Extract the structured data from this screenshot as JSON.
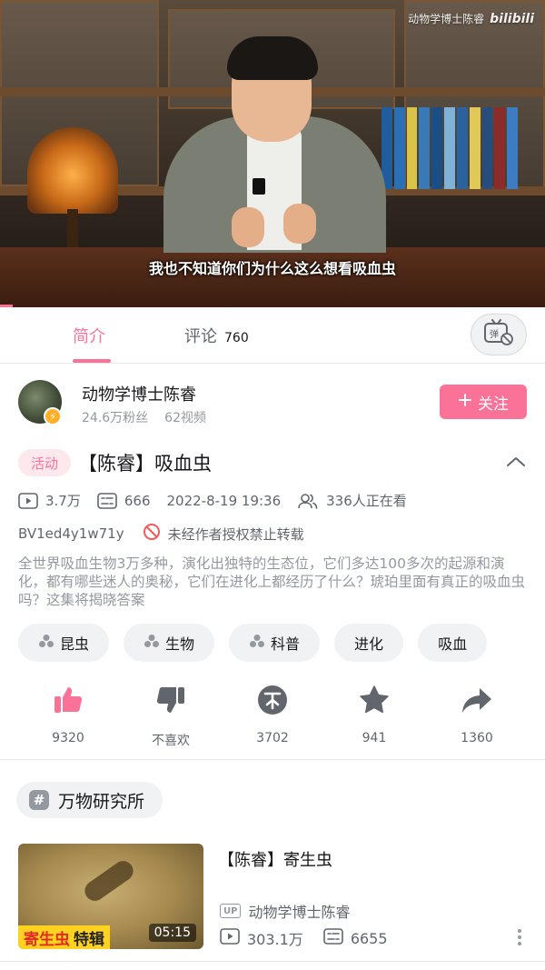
{
  "player": {
    "watermark_text": "动物学博士陈睿",
    "watermark_logo": "bilibili",
    "subtitle": "我也不知道你们为什么这么想看吸血虫"
  },
  "tabs": {
    "intro_label": "简介",
    "comments_label": "评论",
    "comments_count": "760",
    "danmaku_icon": "danmaku-off-icon"
  },
  "uploader": {
    "name": "动物学博士陈睿",
    "fans": "24.6万粉丝",
    "videos": "62视频",
    "follow_label": "关注"
  },
  "video": {
    "activity_tag": "活动",
    "title": "【陈睿】吸血虫",
    "plays": "3.7万",
    "danmaku": "666",
    "datetime": "2022-8-19 19:36",
    "watching": "336人正在看",
    "bvid": "BV1ed4y1w71y",
    "repost_notice": "未经作者授权禁止转载",
    "description": "全世界吸血生物3万多种，演化出独特的生态位，它们多达100多次的起源和演化，都有哪些迷人的奥秘，它们在进化上都经历了什么？琥珀里面有真正的吸血虫吗？这集将揭晓答案"
  },
  "tags": [
    {
      "label": "昆虫",
      "icon": "cluster-icon"
    },
    {
      "label": "生物",
      "icon": "cluster-icon"
    },
    {
      "label": "科普",
      "icon": "cluster-icon"
    },
    {
      "label": "进化"
    },
    {
      "label": "吸血"
    }
  ],
  "actions": {
    "like": "9320",
    "dislike": "不喜欢",
    "coin": "3702",
    "favorite": "941",
    "share": "1360"
  },
  "collection": {
    "label": "万物研究所"
  },
  "related": {
    "title": "【陈睿】寄生虫",
    "up_badge": "UP",
    "up_name": "动物学博士陈睿",
    "plays": "303.1万",
    "danmaku": "6655",
    "duration": "05:15",
    "thumb_text_red": "寄生虫",
    "thumb_text_dark": "特辑"
  },
  "colors": {
    "accent": "#fb7299",
    "text_primary": "#18191c",
    "text_secondary": "#61666d",
    "text_tertiary": "#9499a0"
  }
}
